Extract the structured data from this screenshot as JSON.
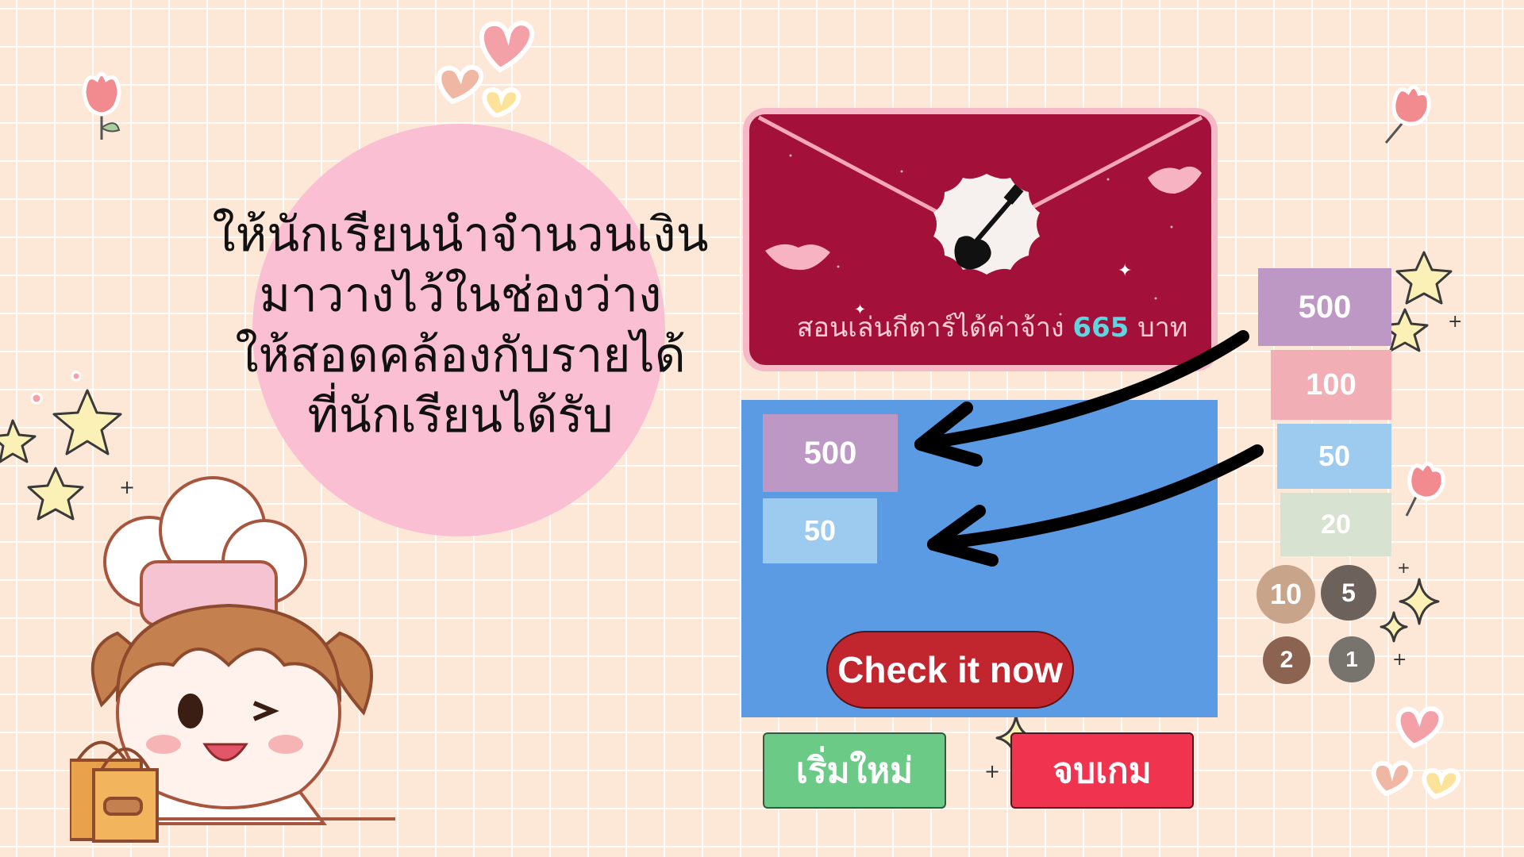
{
  "instruction": {
    "lines": [
      "ให้นักเรียนนำจำนวนเงิน",
      "มาวางไว้ในช่องว่าง",
      "ให้สอดคล้องกับรายได้",
      "ที่นักเรียนได้รับ"
    ]
  },
  "task": {
    "prefix": "สอนเล่นกีตาร์ได้ค่าจ้าง",
    "amount": "665",
    "unit": "บาท",
    "image_icon": "electric-guitar-icon"
  },
  "answer_box": {
    "placed": [
      "500",
      "50"
    ]
  },
  "check_button": {
    "label": "Check it now"
  },
  "restart_button": {
    "label": "เริ่มใหม่"
  },
  "end_button": {
    "label": "จบเกม"
  },
  "palette": {
    "notes": [
      "500",
      "100",
      "50",
      "20"
    ],
    "coins": [
      "10",
      "5",
      "2",
      "1"
    ]
  },
  "colors": {
    "background": "#fde8d7",
    "envelope": "#a3103a",
    "answer_box": "#5a9be3",
    "check_button": "#c1262f",
    "restart_button": "#6bcb86",
    "end_button": "#f0334f",
    "amount_highlight": "#5fd6df"
  }
}
